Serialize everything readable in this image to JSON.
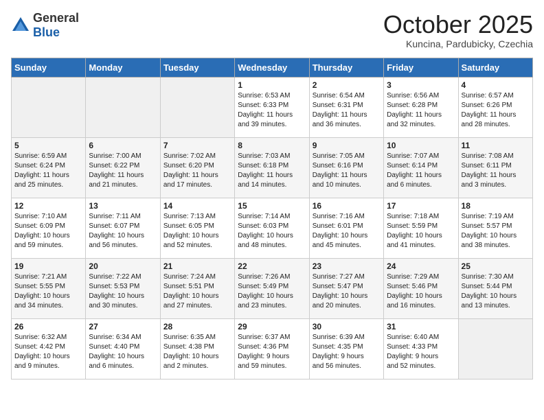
{
  "header": {
    "logo_general": "General",
    "logo_blue": "Blue",
    "month": "October 2025",
    "location": "Kuncina, Pardubicky, Czechia"
  },
  "days_of_week": [
    "Sunday",
    "Monday",
    "Tuesday",
    "Wednesday",
    "Thursday",
    "Friday",
    "Saturday"
  ],
  "weeks": [
    [
      {
        "day": "",
        "info": ""
      },
      {
        "day": "",
        "info": ""
      },
      {
        "day": "",
        "info": ""
      },
      {
        "day": "1",
        "info": "Sunrise: 6:53 AM\nSunset: 6:33 PM\nDaylight: 11 hours\nand 39 minutes."
      },
      {
        "day": "2",
        "info": "Sunrise: 6:54 AM\nSunset: 6:31 PM\nDaylight: 11 hours\nand 36 minutes."
      },
      {
        "day": "3",
        "info": "Sunrise: 6:56 AM\nSunset: 6:28 PM\nDaylight: 11 hours\nand 32 minutes."
      },
      {
        "day": "4",
        "info": "Sunrise: 6:57 AM\nSunset: 6:26 PM\nDaylight: 11 hours\nand 28 minutes."
      }
    ],
    [
      {
        "day": "5",
        "info": "Sunrise: 6:59 AM\nSunset: 6:24 PM\nDaylight: 11 hours\nand 25 minutes."
      },
      {
        "day": "6",
        "info": "Sunrise: 7:00 AM\nSunset: 6:22 PM\nDaylight: 11 hours\nand 21 minutes."
      },
      {
        "day": "7",
        "info": "Sunrise: 7:02 AM\nSunset: 6:20 PM\nDaylight: 11 hours\nand 17 minutes."
      },
      {
        "day": "8",
        "info": "Sunrise: 7:03 AM\nSunset: 6:18 PM\nDaylight: 11 hours\nand 14 minutes."
      },
      {
        "day": "9",
        "info": "Sunrise: 7:05 AM\nSunset: 6:16 PM\nDaylight: 11 hours\nand 10 minutes."
      },
      {
        "day": "10",
        "info": "Sunrise: 7:07 AM\nSunset: 6:14 PM\nDaylight: 11 hours\nand 6 minutes."
      },
      {
        "day": "11",
        "info": "Sunrise: 7:08 AM\nSunset: 6:11 PM\nDaylight: 11 hours\nand 3 minutes."
      }
    ],
    [
      {
        "day": "12",
        "info": "Sunrise: 7:10 AM\nSunset: 6:09 PM\nDaylight: 10 hours\nand 59 minutes."
      },
      {
        "day": "13",
        "info": "Sunrise: 7:11 AM\nSunset: 6:07 PM\nDaylight: 10 hours\nand 56 minutes."
      },
      {
        "day": "14",
        "info": "Sunrise: 7:13 AM\nSunset: 6:05 PM\nDaylight: 10 hours\nand 52 minutes."
      },
      {
        "day": "15",
        "info": "Sunrise: 7:14 AM\nSunset: 6:03 PM\nDaylight: 10 hours\nand 48 minutes."
      },
      {
        "day": "16",
        "info": "Sunrise: 7:16 AM\nSunset: 6:01 PM\nDaylight: 10 hours\nand 45 minutes."
      },
      {
        "day": "17",
        "info": "Sunrise: 7:18 AM\nSunset: 5:59 PM\nDaylight: 10 hours\nand 41 minutes."
      },
      {
        "day": "18",
        "info": "Sunrise: 7:19 AM\nSunset: 5:57 PM\nDaylight: 10 hours\nand 38 minutes."
      }
    ],
    [
      {
        "day": "19",
        "info": "Sunrise: 7:21 AM\nSunset: 5:55 PM\nDaylight: 10 hours\nand 34 minutes."
      },
      {
        "day": "20",
        "info": "Sunrise: 7:22 AM\nSunset: 5:53 PM\nDaylight: 10 hours\nand 30 minutes."
      },
      {
        "day": "21",
        "info": "Sunrise: 7:24 AM\nSunset: 5:51 PM\nDaylight: 10 hours\nand 27 minutes."
      },
      {
        "day": "22",
        "info": "Sunrise: 7:26 AM\nSunset: 5:49 PM\nDaylight: 10 hours\nand 23 minutes."
      },
      {
        "day": "23",
        "info": "Sunrise: 7:27 AM\nSunset: 5:47 PM\nDaylight: 10 hours\nand 20 minutes."
      },
      {
        "day": "24",
        "info": "Sunrise: 7:29 AM\nSunset: 5:46 PM\nDaylight: 10 hours\nand 16 minutes."
      },
      {
        "day": "25",
        "info": "Sunrise: 7:30 AM\nSunset: 5:44 PM\nDaylight: 10 hours\nand 13 minutes."
      }
    ],
    [
      {
        "day": "26",
        "info": "Sunrise: 6:32 AM\nSunset: 4:42 PM\nDaylight: 10 hours\nand 9 minutes."
      },
      {
        "day": "27",
        "info": "Sunrise: 6:34 AM\nSunset: 4:40 PM\nDaylight: 10 hours\nand 6 minutes."
      },
      {
        "day": "28",
        "info": "Sunrise: 6:35 AM\nSunset: 4:38 PM\nDaylight: 10 hours\nand 2 minutes."
      },
      {
        "day": "29",
        "info": "Sunrise: 6:37 AM\nSunset: 4:36 PM\nDaylight: 9 hours\nand 59 minutes."
      },
      {
        "day": "30",
        "info": "Sunrise: 6:39 AM\nSunset: 4:35 PM\nDaylight: 9 hours\nand 56 minutes."
      },
      {
        "day": "31",
        "info": "Sunrise: 6:40 AM\nSunset: 4:33 PM\nDaylight: 9 hours\nand 52 minutes."
      },
      {
        "day": "",
        "info": ""
      }
    ]
  ]
}
